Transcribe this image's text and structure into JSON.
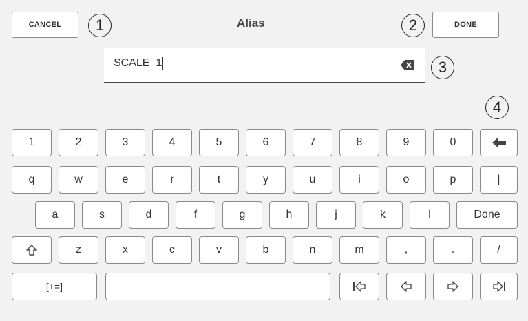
{
  "header": {
    "cancel_label": "CANCEL",
    "title": "Alias",
    "done_label": "DONE"
  },
  "callouts": [
    "1",
    "2",
    "3",
    "4"
  ],
  "input": {
    "value": "SCALE_1"
  },
  "icons": {
    "clear": "backspace-clear-icon",
    "backspace": "arrow-left-icon",
    "shift": "shift-up-icon",
    "home": "cursor-home-icon",
    "left": "cursor-left-icon",
    "right": "cursor-right-icon",
    "end": "cursor-end-icon"
  },
  "keyboard": {
    "row1": [
      "1",
      "2",
      "3",
      "4",
      "5",
      "6",
      "7",
      "8",
      "9",
      "0"
    ],
    "row2": [
      "q",
      "w",
      "e",
      "r",
      "t",
      "y",
      "u",
      "i",
      "o",
      "p",
      "|"
    ],
    "row3": [
      "a",
      "s",
      "d",
      "f",
      "g",
      "h",
      "j",
      "k",
      "l",
      "Done"
    ],
    "row4": [
      "z",
      "x",
      "c",
      "v",
      "b",
      "n",
      "m",
      ",",
      ".",
      "/"
    ],
    "row5": {
      "symbols_label": "[+=]"
    }
  }
}
